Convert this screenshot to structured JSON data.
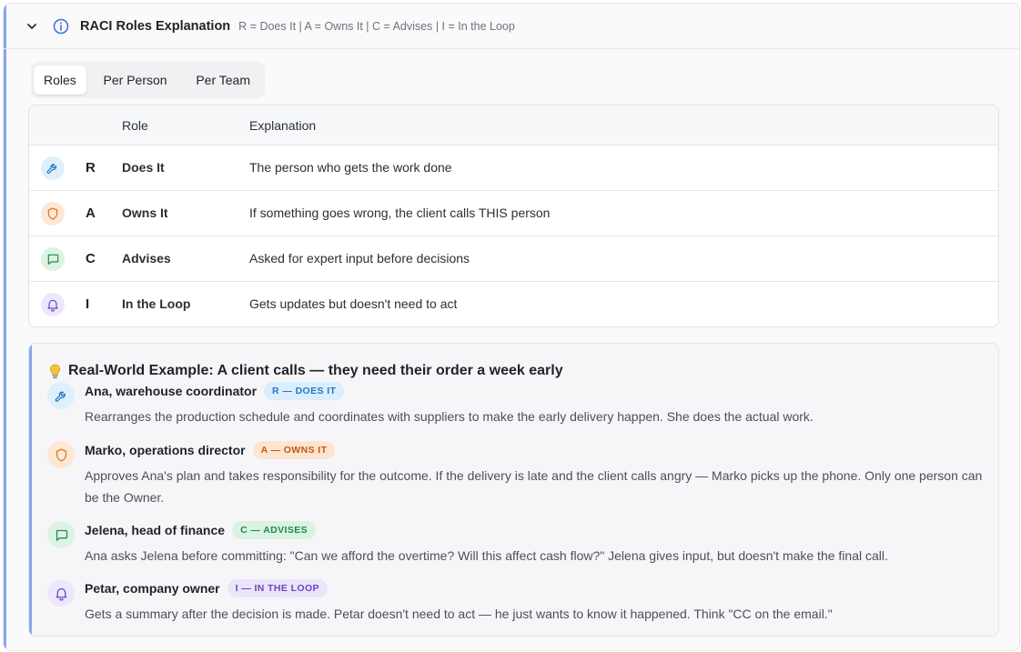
{
  "header": {
    "title": "RACI Roles Explanation",
    "subtitle": "R = Does It | A = Owns It | C = Advises | I = In the Loop",
    "icon": "info-icon",
    "toggle_icon": "chevron-down-icon"
  },
  "tabs": [
    {
      "label": "Roles",
      "active": true
    },
    {
      "label": "Per Person",
      "active": false
    },
    {
      "label": "Per Team",
      "active": false
    }
  ],
  "table": {
    "headers": {
      "role": "Role",
      "explanation": "Explanation"
    },
    "rows": [
      {
        "icon": "wrench-icon",
        "letter": "R",
        "role": "Does It",
        "explanation": "The person who gets the work done"
      },
      {
        "icon": "shield-icon",
        "letter": "A",
        "role": "Owns It",
        "explanation": "If something goes wrong, the client calls THIS person"
      },
      {
        "icon": "message-icon",
        "letter": "C",
        "role": "Advises",
        "explanation": "Asked for expert input before decisions"
      },
      {
        "icon": "bell-icon",
        "letter": "I",
        "role": "In the Loop",
        "explanation": "Gets updates but doesn't need to act"
      }
    ]
  },
  "example": {
    "icon": "lightbulb-icon",
    "title": "Real-World Example: A client calls — they need their order a week early",
    "people": [
      {
        "name": "Ana, warehouse coordinator",
        "badge": "R — DOES IT",
        "icon": "wrench-icon",
        "description": "Rearranges the production schedule and coordinates with suppliers to make the early delivery happen. She does the actual work."
      },
      {
        "name": "Marko, operations director",
        "badge": "A — OWNS IT",
        "icon": "shield-icon",
        "description": "Approves Ana's plan and takes responsibility for the outcome. If the delivery is late and the client calls angry — Marko picks up the phone. Only one person can be the Owner."
      },
      {
        "name": "Jelena, head of finance",
        "badge": "C — ADVISES",
        "icon": "message-icon",
        "description": "Ana asks Jelena before committing: \"Can we afford the overtime? Will this affect cash flow?\" Jelena gives input, but doesn't make the final call."
      },
      {
        "name": "Petar, company owner",
        "badge": "I — IN THE LOOP",
        "icon": "bell-icon",
        "description": "Gets a summary after the decision is made. Petar doesn't need to act — he just wants to know it happened. Think \"CC on the email.\""
      }
    ]
  },
  "colors": {
    "accent": "#8aa4f0",
    "responsible": "#1f7ac9",
    "accountable": "#e07a1f",
    "consulted": "#1e8a4c",
    "informed": "#6a46c4"
  }
}
